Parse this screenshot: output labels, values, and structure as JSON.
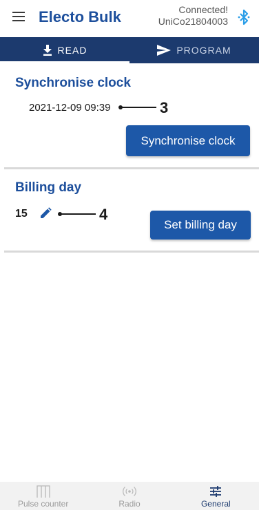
{
  "header": {
    "title": "Electo Bulk",
    "status": "Connected!",
    "device": "UniCo21804003"
  },
  "tabs": [
    {
      "label": "READ",
      "icon": "download-icon",
      "active": true
    },
    {
      "label": "PROGRAM",
      "icon": "send-icon",
      "active": false
    }
  ],
  "clock": {
    "title": "Synchronise clock",
    "datetime": "2021-12-09 09:39",
    "callout": "3",
    "button_label": "Synchronise clock"
  },
  "billing": {
    "title": "Billing day",
    "day": "15",
    "callout": "4",
    "button_label": "Set billing day"
  },
  "bottom_nav": [
    {
      "label": "Pulse counter",
      "icon": "pulse-counter-icon",
      "selected": false
    },
    {
      "label": "Radio",
      "icon": "radio-icon",
      "selected": false
    },
    {
      "label": "General",
      "icon": "sliders-icon",
      "selected": true
    }
  ],
  "colors": {
    "brand": "#1d4f9c",
    "tab_bar": "#1c3a6e",
    "button": "#1d58a8",
    "bluetooth": "#2a9ee8"
  }
}
